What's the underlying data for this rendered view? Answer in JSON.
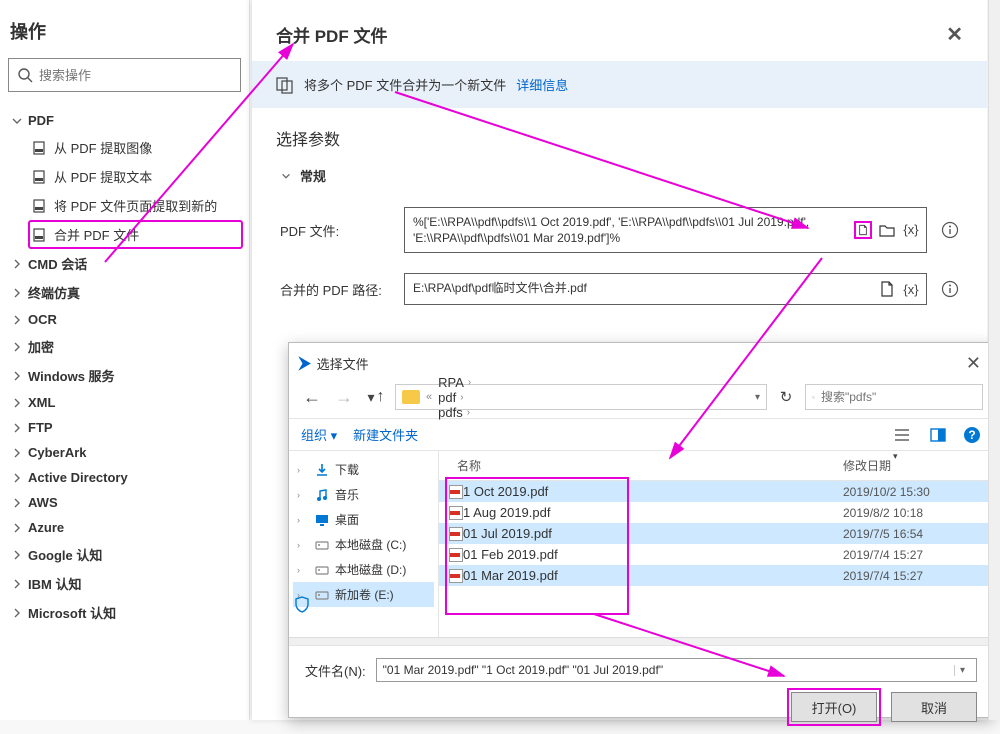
{
  "sidebar": {
    "title": "操作",
    "search_placeholder": "搜索操作",
    "pdf_group": "PDF",
    "pdf_items": [
      "从 PDF 提取图像",
      "从 PDF 提取文本",
      "将 PDF 文件页面提取到新的",
      "合并 PDF 文件"
    ],
    "groups": [
      "CMD 会话",
      "终端仿真",
      "OCR",
      "加密",
      "Windows 服务",
      "XML",
      "FTP",
      "CyberArk",
      "Active Directory",
      "AWS",
      "Azure",
      "Google 认知",
      "IBM 认知",
      "Microsoft 认知"
    ]
  },
  "dialog": {
    "title": "合并 PDF 文件",
    "info_text": "将多个 PDF 文件合并为一个新文件",
    "info_link": "详细信息",
    "params_title": "选择参数",
    "group_general": "常规",
    "label_pdf_files": "PDF 文件:",
    "value_pdf_files": "%['E:\\\\RPA\\\\pdf\\\\pdfs\\\\1 Oct 2019.pdf', 'E:\\\\RPA\\\\pdf\\\\pdfs\\\\01 Jul 2019.pdf', 'E:\\\\RPA\\\\pdf\\\\pdfs\\\\01 Mar 2019.pdf']%",
    "label_merged_path": "合并的 PDF 路径:",
    "value_merged_path": "E:\\RPA\\pdf\\pdf临时文件\\合并.pdf",
    "var_token": "{x}"
  },
  "picker": {
    "title": "选择文件",
    "crumb": [
      "RPA",
      "pdf",
      "pdfs"
    ],
    "search_placeholder": "搜索\"pdfs\"",
    "organize": "组织 ▾",
    "new_folder": "新建文件夹",
    "sidebar_items": [
      {
        "label": "下载",
        "icon": "download"
      },
      {
        "label": "音乐",
        "icon": "music"
      },
      {
        "label": "桌面",
        "icon": "desktop"
      },
      {
        "label": "本地磁盘 (C:)",
        "icon": "disk"
      },
      {
        "label": "本地磁盘 (D:)",
        "icon": "disk"
      },
      {
        "label": "新加卷 (E:)",
        "icon": "disk"
      }
    ],
    "col_name": "名称",
    "col_date": "修改日期",
    "files": [
      {
        "name": "1 Oct 2019.pdf",
        "date": "2019/10/2 15:30",
        "sel": true
      },
      {
        "name": "1 Aug 2019.pdf",
        "date": "2019/8/2 10:18",
        "sel": false
      },
      {
        "name": "01 Jul 2019.pdf",
        "date": "2019/7/5 16:54",
        "sel": true
      },
      {
        "name": "01 Feb 2019.pdf",
        "date": "2019/7/4 15:27",
        "sel": false
      },
      {
        "name": "01 Mar 2019.pdf",
        "date": "2019/7/4 15:27",
        "sel": true
      }
    ],
    "filename_label": "文件名(N):",
    "filename_value": "\"01 Mar 2019.pdf\" \"1 Oct 2019.pdf\" \"01 Jul 2019.pdf\"",
    "btn_open": "打开(O)",
    "btn_cancel": "取消"
  }
}
